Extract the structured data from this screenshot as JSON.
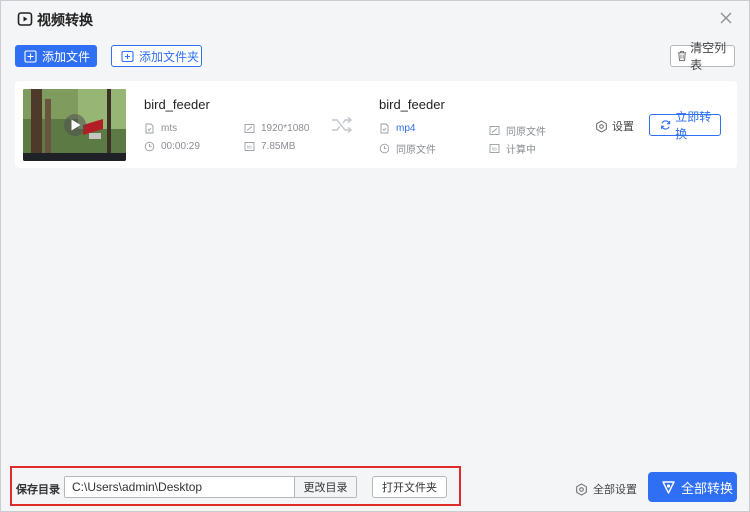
{
  "window": {
    "title": "视频转换"
  },
  "toolbar": {
    "add_file_label": "添加文件",
    "add_folder_label": "添加文件夹",
    "clear_list_label": "清空列表"
  },
  "files": [
    {
      "source": {
        "name": "bird_feeder",
        "format": "mts",
        "resolution": "1920*1080",
        "duration": "00:00:29",
        "size": "7.85MB"
      },
      "target": {
        "name": "bird_feeder",
        "format": "mp4",
        "resolution": "同原文件",
        "duration": "同原文件",
        "size": "计算中"
      },
      "settings_label": "设置",
      "convert_label": "立即转换"
    }
  ],
  "footer": {
    "save_dir_label": "保存目录",
    "save_path": "C:\\Users\\admin\\Desktop",
    "change_dir_label": "更改目录",
    "open_folder_label": "打开文件夹",
    "all_settings_label": "全部设置",
    "convert_all_label": "全部转换"
  },
  "colors": {
    "accent": "#2f6ff4",
    "highlight": "#e02b2b"
  }
}
